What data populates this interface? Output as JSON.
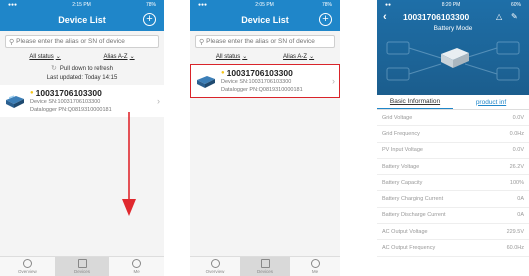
{
  "device_list": {
    "title": "Device List",
    "search_placeholder": "Please enter the alias or SN of device",
    "filter_status": "All status",
    "filter_sort": "Alias A-Z",
    "refresh_hint": "Pull down to refresh",
    "last_updated": "Last updated: Today 14:15",
    "device": {
      "name": "10031706103300",
      "sn": "Device SN:10031706103300",
      "datalogger": "Datalogger PN:Q0819310000181"
    },
    "tabs": [
      "Overview",
      "Devices",
      "Me"
    ],
    "active_tab": "Devices"
  },
  "status_bar": {
    "time_1": "2:15 PM",
    "time_2": "2:05 PM",
    "time_3": "8:20 PM",
    "battery_1": "78%",
    "battery_2": "78%",
    "battery_3": "60%"
  },
  "device_detail": {
    "title": "10031706103300",
    "mode": "Battery Mode",
    "tabs": [
      "Basic Information",
      "product inf"
    ],
    "rows": [
      {
        "label": "Grid Voltage",
        "value": "0.0V"
      },
      {
        "label": "Grid Frequency",
        "value": "0.0Hz"
      },
      {
        "label": "PV Input Voltage",
        "value": "0.0V"
      },
      {
        "label": "Battery Voltage",
        "value": "26.2V"
      },
      {
        "label": "Battery Capacity",
        "value": "100%"
      },
      {
        "label": "Battery Charging Current",
        "value": "0A"
      },
      {
        "label": "Battery Discharge Current",
        "value": "0A"
      },
      {
        "label": "AC Output Voltage",
        "value": "229.5V"
      },
      {
        "label": "AC Output Frequency",
        "value": "60.0Hz"
      }
    ]
  },
  "colors": {
    "header_blue": "#1f86c9",
    "highlight_red": "#d9242a",
    "star_yellow": "#f5c518"
  }
}
